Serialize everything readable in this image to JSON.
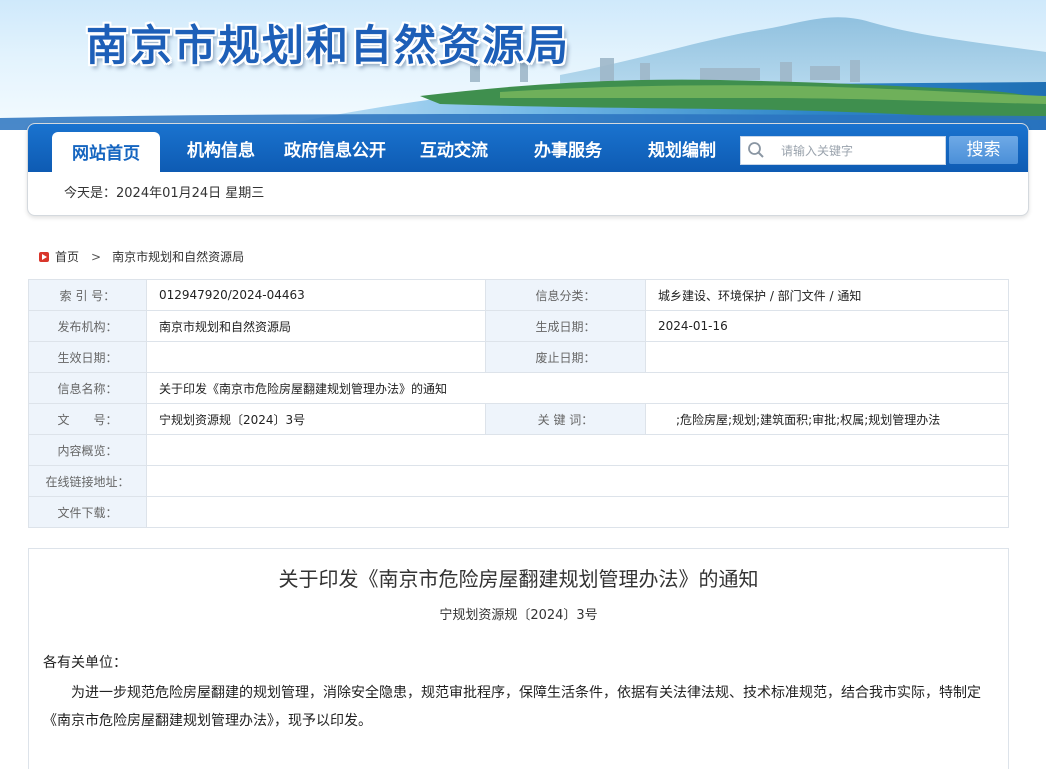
{
  "site": {
    "title": "南京市规划和自然资源局"
  },
  "nav": {
    "items": [
      {
        "label": "网站首页",
        "active": true
      },
      {
        "label": "机构信息"
      },
      {
        "label": "政府信息公开"
      },
      {
        "label": "互动交流"
      },
      {
        "label": "办事服务"
      },
      {
        "label": "规划编制"
      }
    ],
    "search_placeholder": "请输入关键字",
    "search_button": "搜索",
    "today": "今天是：2024年01月24日  星期三"
  },
  "breadcrumb": {
    "home": "首页",
    "separator": ">",
    "current": "南京市规划和自然资源局"
  },
  "info_table": {
    "index_label": "索 引 号：",
    "index_value": "012947920/2024-04463",
    "category_label": "信息分类：",
    "category_value": "城乡建设、环境保护 / 部门文件 / 通知",
    "publisher_label": "发布机构：",
    "publisher_value": "南京市规划和自然资源局",
    "created_label": "生成日期：",
    "created_value": "2024-01-16",
    "effective_label": "生效日期：",
    "effective_value": "",
    "repeal_label": "废止日期：",
    "repeal_value": "",
    "name_label": "信息名称：",
    "name_value": "关于印发《南京市危险房屋翻建规划管理办法》的通知",
    "docno_label": "文　　号：",
    "docno_value": "宁规划资源规〔2024〕3号",
    "keywords_label": "关 键 词：",
    "keywords_value": ";危险房屋;规划;建筑面积;审批;权属;规划管理办法",
    "preview_label": "内容概览：",
    "preview_value": "",
    "link_label": "在线链接地址：",
    "link_value": "",
    "download_label": "文件下载：",
    "download_value": ""
  },
  "article": {
    "title": "关于印发《南京市危险房屋翻建规划管理办法》的通知",
    "doc_number": "宁规划资源规〔2024〕3号",
    "salutation": "各有关单位：",
    "body_line1": "为进一步规范危险房屋翻建的规划管理，消除安全隐患，规范审批程序，保障生活条件，依据有关法律法规、技术标准规范，结合我市实际，特制定",
    "body_line2": "《南京市危险房屋翻建规划管理办法》，现予以印发。"
  },
  "colors": {
    "nav_bar": "#1a73cf",
    "active_tab_text": "#1565c0",
    "search_button": "#4a8fd8",
    "label_cell": "#eef4fb",
    "breadcrumb_icon": "#d9362b"
  }
}
